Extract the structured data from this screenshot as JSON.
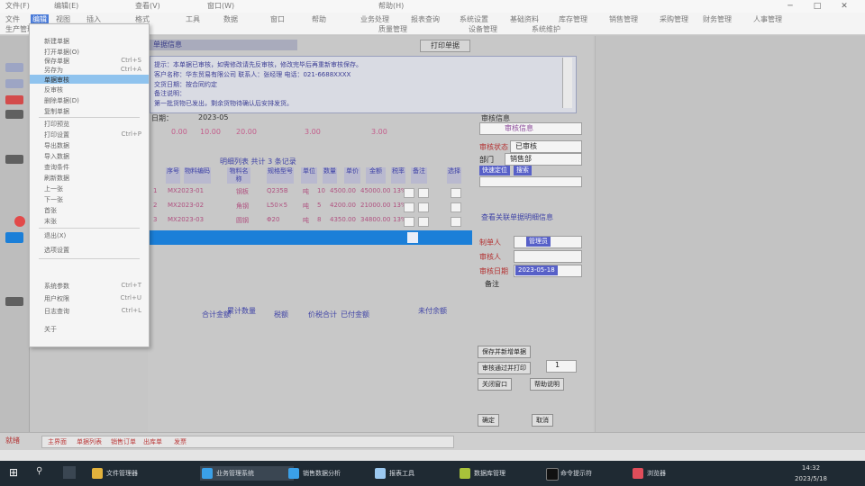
{
  "window": {
    "title_segments": [
      "文件(F)",
      "编辑(E)",
      "查看(V)",
      "窗口(W)",
      "帮助(H)"
    ],
    "controls": [
      "─",
      "□",
      "✕"
    ]
  },
  "menubar": {
    "items": [
      "文件",
      "编辑",
      "视图",
      "插入",
      "格式",
      "工具",
      "数据",
      "窗口",
      "帮助",
      "业务处理",
      "报表查询",
      "系统设置",
      "基础资料",
      "库存管理",
      "销售管理",
      "采购管理",
      "财务管理",
      "人事管理",
      "生产管理",
      "质量管理",
      "设备管理",
      "系统维护"
    ],
    "active_index": 1
  },
  "dropdown": {
    "items": [
      {
        "label": "新建单据",
        "shortcut": ""
      },
      {
        "label": "打开单据(O)",
        "shortcut": ""
      },
      {
        "label": "保存单据",
        "shortcut": "Ctrl+S"
      },
      {
        "label": "另存为",
        "shortcut": "Ctrl+A"
      },
      {
        "label": "单据审核",
        "shortcut": ""
      },
      {
        "label": "反审核",
        "shortcut": ""
      },
      {
        "label": "删除单据(D)",
        "shortcut": ""
      },
      {
        "label": "复制单据",
        "shortcut": ""
      },
      {
        "label": "打印预览",
        "shortcut": ""
      },
      {
        "label": "打印设置",
        "shortcut": "Ctrl+P"
      },
      {
        "label": "导出数据",
        "shortcut": ""
      },
      {
        "label": "导入数据",
        "shortcut": ""
      },
      {
        "label": "查询条件",
        "shortcut": ""
      },
      {
        "label": "刷新数据",
        "shortcut": ""
      },
      {
        "label": "上一张",
        "shortcut": ""
      },
      {
        "label": "下一张",
        "shortcut": ""
      },
      {
        "label": "首张",
        "shortcut": ""
      },
      {
        "label": "末张",
        "shortcut": ""
      },
      {
        "label": "退出(X)",
        "shortcut": ""
      },
      {
        "label": "选项设置",
        "shortcut": ""
      },
      {
        "label": "系统参数",
        "shortcut": "Ctrl+T"
      },
      {
        "label": "用户权限",
        "shortcut": "Ctrl+U"
      },
      {
        "label": "日志查询",
        "shortcut": "Ctrl+L"
      },
      {
        "label": "关于",
        "shortcut": ""
      }
    ],
    "highlighted_index": 4
  },
  "panel": {
    "tab_label": "单据信息",
    "button_label": "打印单据",
    "info_lines": [
      "提示：本单据已审核，如需修改请先反审核，修改完毕后再重新审核保存。",
      "客户名称：华东贸易有限公司  联系人：张经理  电话：021-6688XXXX",
      "交货日期：按合同约定",
      "备注说明：",
      "第一批货物已发出，剩余货物待确认后安排发货。"
    ],
    "summary": {
      "label1": "日期：",
      "value1": "2023-05",
      "fields": [
        "0.00",
        "20.00",
        "3.00",
        "3.00",
        "10.00"
      ]
    },
    "grid_title": "明细列表  共计 3 条记录",
    "columns": [
      "序号",
      "物料编码",
      "物料名称",
      "规格型号",
      "单位",
      "数量",
      "单价",
      "金额",
      "税率",
      "备注",
      "选择"
    ],
    "rows": [
      [
        "1",
        "MX2023-01",
        "钢板",
        "Q235B",
        "吨",
        "10",
        "4500.00",
        "45000.00",
        "13%",
        ""
      ],
      [
        "2",
        "MX2023-02",
        "角钢",
        "L50×5",
        "吨",
        "5",
        "4200.00",
        "21000.00",
        "13%",
        ""
      ],
      [
        "3",
        "MX2023-03",
        "圆钢",
        "Φ20",
        "吨",
        "8",
        "4350.00",
        "34800.00",
        "13%",
        ""
      ]
    ],
    "selected_row_text": "",
    "bottom_labels": [
      "合计金额",
      "累计数量",
      "税额",
      "价税合计",
      "已付金额",
      "未付余额"
    ]
  },
  "right_controls": {
    "title": "审核信息",
    "status_label": "审核状态",
    "status_value": "已审核",
    "dept_label": "部门",
    "dept_value": "销售部",
    "search_label": "快速定位",
    "search_button": "搜索",
    "link_text": "查看关联单据明细信息",
    "field1_label": "制单人",
    "field1_value": "管理员",
    "field2_label": "审核人",
    "field2_value": "",
    "field3_label": "审核日期",
    "field3_value": "2023-05-18",
    "small_label": "备注",
    "btn_a": "保存并新增单据",
    "btn_b": "审核通过并打印",
    "btn_c_value": "1",
    "btn_d": "关闭窗口",
    "btn_e": "帮助说明",
    "btn_f": "确定",
    "btn_g": "取消"
  },
  "statusbar": {
    "left_text": "就绪",
    "tabs": [
      "主界面",
      "单据列表",
      "销售订单",
      "出库单",
      "发票"
    ],
    "right_text": ""
  },
  "taskbar": {
    "items": [
      "文件管理器",
      "业务管理系统",
      "销售数据分析",
      "报表工具",
      "数据库管理",
      "命令提示符",
      "浏览器"
    ],
    "clock_time": "14:32",
    "clock_date": "2023/5/18"
  }
}
